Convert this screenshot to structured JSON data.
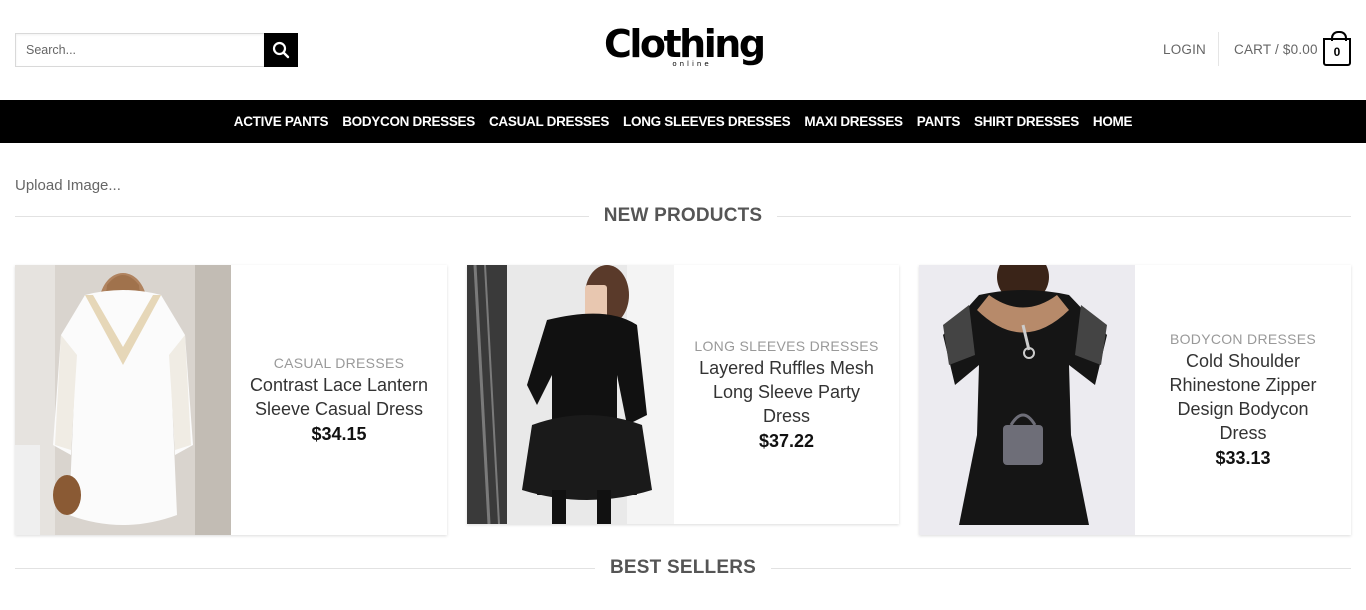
{
  "header": {
    "search": {
      "placeholder": "Search..."
    },
    "logo": {
      "main": "Clothing",
      "sub": "online"
    },
    "login_label": "LOGIN",
    "cart_label": "CART / $0.00",
    "cart_count": "0"
  },
  "nav": {
    "items": [
      "ACTIVE PANTS",
      "BODYCON DRESSES",
      "CASUAL DRESSES",
      "LONG SLEEVES DRESSES",
      "MAXI DRESSES",
      "PANTS",
      "SHIRT DRESSES",
      "HOME"
    ]
  },
  "main": {
    "upload_label": "Upload Image...",
    "new_products_title": "NEW PRODUCTS",
    "best_sellers_title": "BEST SELLERS",
    "products": [
      {
        "category": "CASUAL DRESSES",
        "name": "Contrast Lace Lantern Sleeve Casual Dress",
        "price": "$34.15"
      },
      {
        "category": "LONG SLEEVES DRESSES",
        "name": "Layered Ruffles Mesh Long Sleeve Party Dress",
        "price": "$37.22"
      },
      {
        "category": "BODYCON DRESSES",
        "name": "Cold Shoulder Rhinestone Zipper Design Bodycon Dress",
        "price": "$33.13"
      }
    ]
  },
  "colors": {
    "nav_bg": "#000000",
    "text_muted": "#999999",
    "accent": "#000000"
  },
  "icons": {
    "search": "search-icon",
    "cart": "shopping-bag-icon"
  }
}
